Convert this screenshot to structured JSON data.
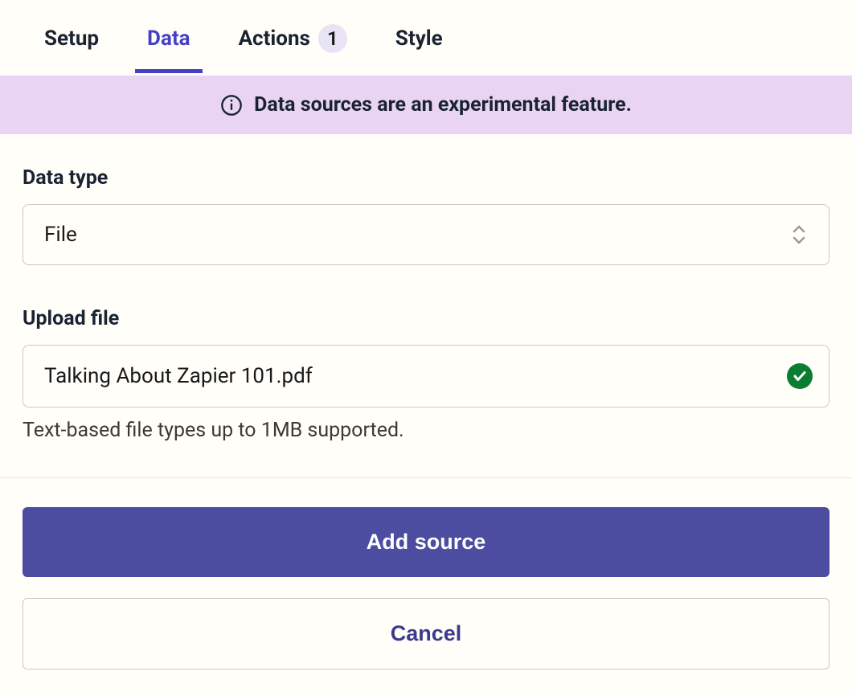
{
  "tabs": {
    "setup": "Setup",
    "data": "Data",
    "actions": "Actions",
    "actions_badge": "1",
    "style": "Style"
  },
  "banner": {
    "text": "Data sources are an experimental feature."
  },
  "form": {
    "data_type_label": "Data type",
    "data_type_value": "File",
    "upload_label": "Upload file",
    "upload_value": "Talking About Zapier 101.pdf",
    "upload_hint": "Text-based file types up to 1MB supported."
  },
  "buttons": {
    "primary": "Add source",
    "secondary": "Cancel"
  }
}
